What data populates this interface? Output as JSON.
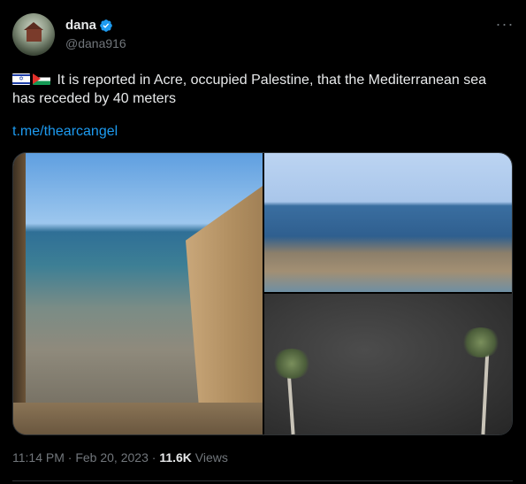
{
  "author": {
    "name": "dana",
    "handle": "@dana916",
    "verified": true
  },
  "more_icon": "more-dots-icon",
  "tweet": {
    "flags": [
      "israel-flag",
      "palestine-flag"
    ],
    "text": "It is reported in Acre, occupied Palestine, that the Mediterranean sea has receded by 40 meters",
    "link": "t.me/thearcangel"
  },
  "meta": {
    "time": "11:14 PM",
    "sep1": "·",
    "date": "Feb 20, 2023",
    "sep2": "·",
    "views_count": "11.6K",
    "views_label": "Views"
  },
  "colors": {
    "background": "#000000",
    "text": "#e7e9ea",
    "secondary": "#71767b",
    "link": "#1d9bf0",
    "verified": "#1d9bf0"
  }
}
